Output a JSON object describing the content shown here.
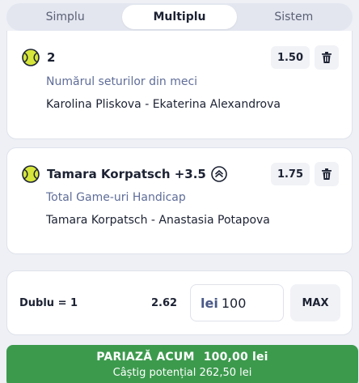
{
  "tabs": [
    {
      "label": "Simplu",
      "active": false
    },
    {
      "label": "Multiplu",
      "active": true
    },
    {
      "label": "Sistem",
      "active": false
    }
  ],
  "selections": [
    {
      "icon": "tennis-ball-icon",
      "selection": "2",
      "market": "Numărul seturilor din meci",
      "event": "Karolina Pliskova - Ekaterina Alexandrova",
      "odd": "1.50"
    },
    {
      "icon": "tennis-ball-icon",
      "selection": "Tamara Korpatsch +3.5",
      "boost_icon": "odds-boost-icon",
      "market": "Total Game-uri Handicap",
      "event": "Tamara Korpatsch - Anastasia Potapova",
      "odd": "1.75"
    }
  ],
  "stake": {
    "combo_label": "Dublu = 1",
    "combo_odd": "2.62",
    "currency": "lei",
    "amount": "100",
    "max_label": "MAX"
  },
  "place_bet": {
    "label": "PARIAZĂ ACUM",
    "stake_text": "100,00 lei",
    "potential_win": "Câștig potențial 262,50 lei"
  },
  "colors": {
    "accent_green": "#3c9a4d",
    "tennis_ball": "#d6e63a",
    "market_text": "#5f6d98"
  }
}
